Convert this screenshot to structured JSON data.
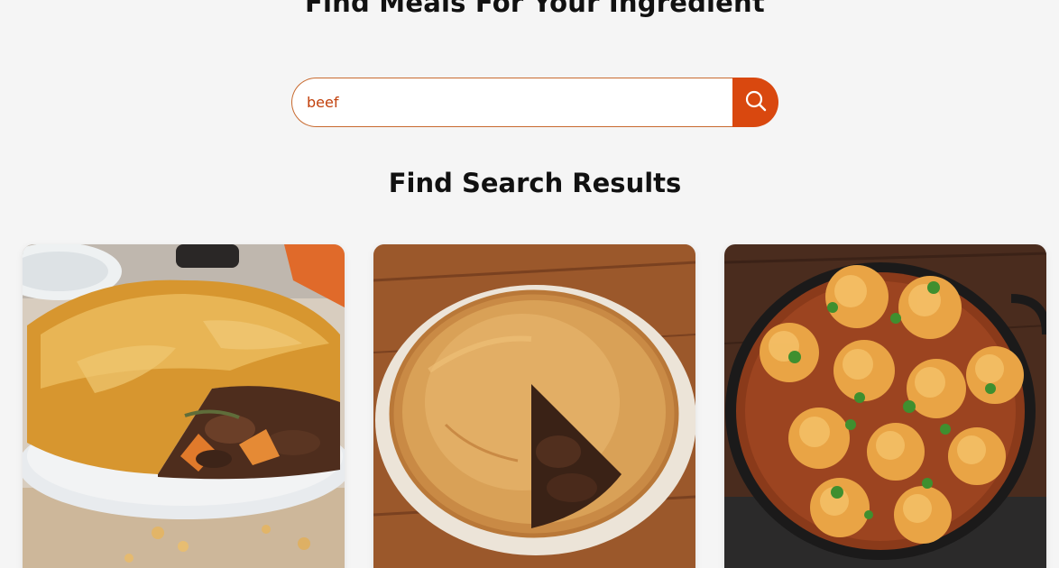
{
  "hero": {
    "title": "Find Meals For Your Ingredient"
  },
  "search": {
    "value": "beef",
    "button_icon": "search-icon"
  },
  "results": {
    "title": "Find Search Results",
    "cards": [
      {
        "image": "beef-pie-image"
      },
      {
        "image": "steak-pie-image"
      },
      {
        "image": "beef-cobbler-image"
      }
    ]
  },
  "colors": {
    "accent": "#d9480f",
    "border": "#c86a2f",
    "background": "#f5f5f5",
    "text": "#111111"
  }
}
